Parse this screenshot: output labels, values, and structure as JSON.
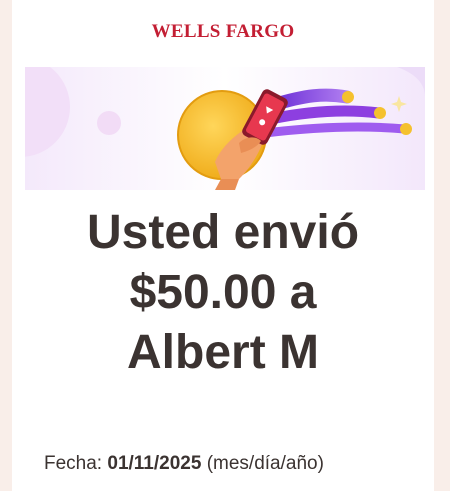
{
  "header": {
    "brand": "WELLS FARGO"
  },
  "hero": {
    "icon": "phone-tap-coin-illustration"
  },
  "message": {
    "line1": "Usted envió",
    "line2": "$50.00 a",
    "line3": "Albert M"
  },
  "details": {
    "date_label": "Fecha:",
    "date_value": "01/11/2025",
    "date_format": "(mes/día/año)"
  },
  "colors": {
    "brand_red": "#c31e33",
    "text": "#3b3331",
    "page_bg": "#f9eee9",
    "accent_purple": "#8d3fe0",
    "accent_yellow": "#f5c12e"
  }
}
